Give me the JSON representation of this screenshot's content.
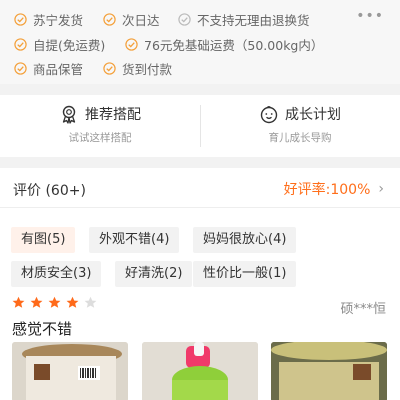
{
  "services": {
    "more_label": "•••",
    "items": [
      {
        "label": "苏宁发货",
        "status": "available"
      },
      {
        "label": "次日达",
        "status": "available"
      },
      {
        "label": "不支持无理由退换货",
        "status": "unavailable"
      },
      {
        "label": "自提(免运费)",
        "status": "available"
      },
      {
        "label": "76元免基础运费（50.00kg内）",
        "status": "available"
      },
      {
        "label": "商品保管",
        "status": "available"
      },
      {
        "label": "货到付款",
        "status": "available"
      }
    ]
  },
  "recommend": {
    "left_title": "推荐搭配",
    "left_sub": "试试这样搭配",
    "left_icon": "award-ribbon-icon",
    "right_title": "成长计划",
    "right_sub": "育儿成长导购",
    "right_icon": "baby-face-icon"
  },
  "reviews": {
    "title": "评价 (60+)",
    "good_rate": "好评率:100%",
    "chevron": "›",
    "tags": [
      {
        "label": "有图(5)",
        "active": true
      },
      {
        "label": "外观不错(4)",
        "active": false
      },
      {
        "label": "妈妈很放心(4)",
        "active": false
      },
      {
        "label": "材质安全(3)",
        "active": false
      },
      {
        "label": "好清洗(2)",
        "active": false
      },
      {
        "label": "性价比一般(1)",
        "active": false
      }
    ],
    "first_review": {
      "rating": 4,
      "max_rating": 5,
      "reviewer": "硕***恒",
      "text": "感觉不错"
    }
  },
  "colors": {
    "accent": "#ff6e1a",
    "check_orange": "#f4a03a",
    "check_grey": "#bbbbbb",
    "star_filled": "#ff6a1a",
    "star_empty": "#dddddd"
  }
}
